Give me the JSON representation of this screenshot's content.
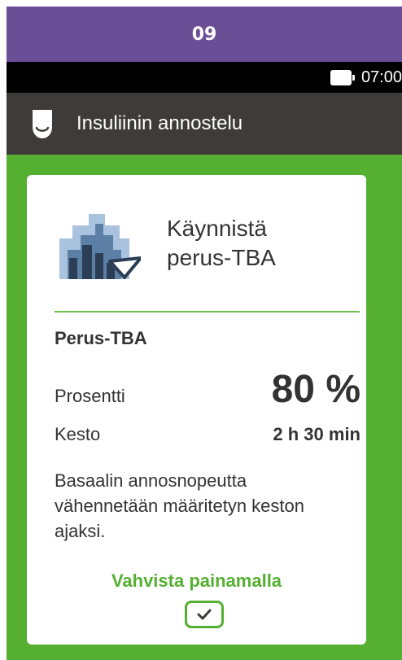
{
  "banner": {
    "number": "09"
  },
  "status": {
    "time": "07:00"
  },
  "header": {
    "title": "Insuliinin annostelu"
  },
  "card": {
    "heading": "Käynnistä\nperus-TBA",
    "subtitle": "Perus-TBA",
    "percent": {
      "label": "Prosentti",
      "value": "80 %"
    },
    "duration": {
      "label": "Kesto",
      "value": "2 h 30 min"
    },
    "description": "Basaalin annosnopeutta vähennetään määritetyn keston ajaksi.",
    "confirm_label": "Vahvista painamalla"
  },
  "colors": {
    "banner": "#6a4f97",
    "header": "#3f3b38",
    "accent": "#55b032"
  },
  "icons": [
    "battery-icon",
    "insulin-pump-icon",
    "temp-basal-icon",
    "checkmark-icon"
  ]
}
